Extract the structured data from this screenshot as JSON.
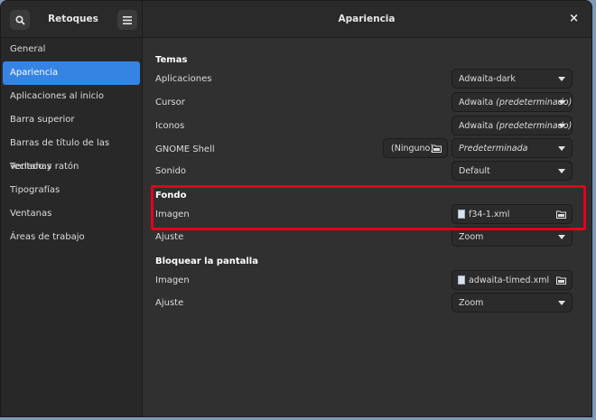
{
  "header": {
    "app_title": "Retoques",
    "page_title": "Apariencia",
    "close_glyph": "×"
  },
  "sidebar": {
    "items": [
      {
        "label": "General"
      },
      {
        "label": "Apariencia"
      },
      {
        "label": "Aplicaciones al inicio"
      },
      {
        "label": "Barra superior"
      },
      {
        "label": "Barras de título de las ventanas"
      },
      {
        "label": "Teclado y ratón"
      },
      {
        "label": "Tipografías"
      },
      {
        "label": "Ventanas"
      },
      {
        "label": "Áreas de trabajo"
      }
    ]
  },
  "temas": {
    "heading": "Temas",
    "aplicaciones": {
      "label": "Aplicaciones",
      "value": "Adwaita-dark"
    },
    "cursor": {
      "label": "Cursor",
      "value_prefix": "Adwaita ",
      "value_suffix": "(predeterminado)"
    },
    "iconos": {
      "label": "Iconos",
      "value_prefix": "Adwaita ",
      "value_suffix": "(predeterminado)"
    },
    "shell": {
      "label": "GNOME Shell",
      "none_label": "(Ninguno)",
      "value": "Predeterminada"
    },
    "sonido": {
      "label": "Sonido",
      "value": "Default"
    }
  },
  "fondo": {
    "heading": "Fondo",
    "imagen": {
      "label": "Imagen",
      "file": "f34-1.xml"
    },
    "ajuste": {
      "label": "Ajuste",
      "value": "Zoom"
    }
  },
  "bloqueo": {
    "heading": "Bloquear la pantalla",
    "imagen": {
      "label": "Imagen",
      "file": "adwaita-timed.xml"
    },
    "ajuste": {
      "label": "Ajuste",
      "value": "Zoom"
    }
  },
  "colors": {
    "accent": "#3584e4",
    "highlight": "#e3001b"
  }
}
